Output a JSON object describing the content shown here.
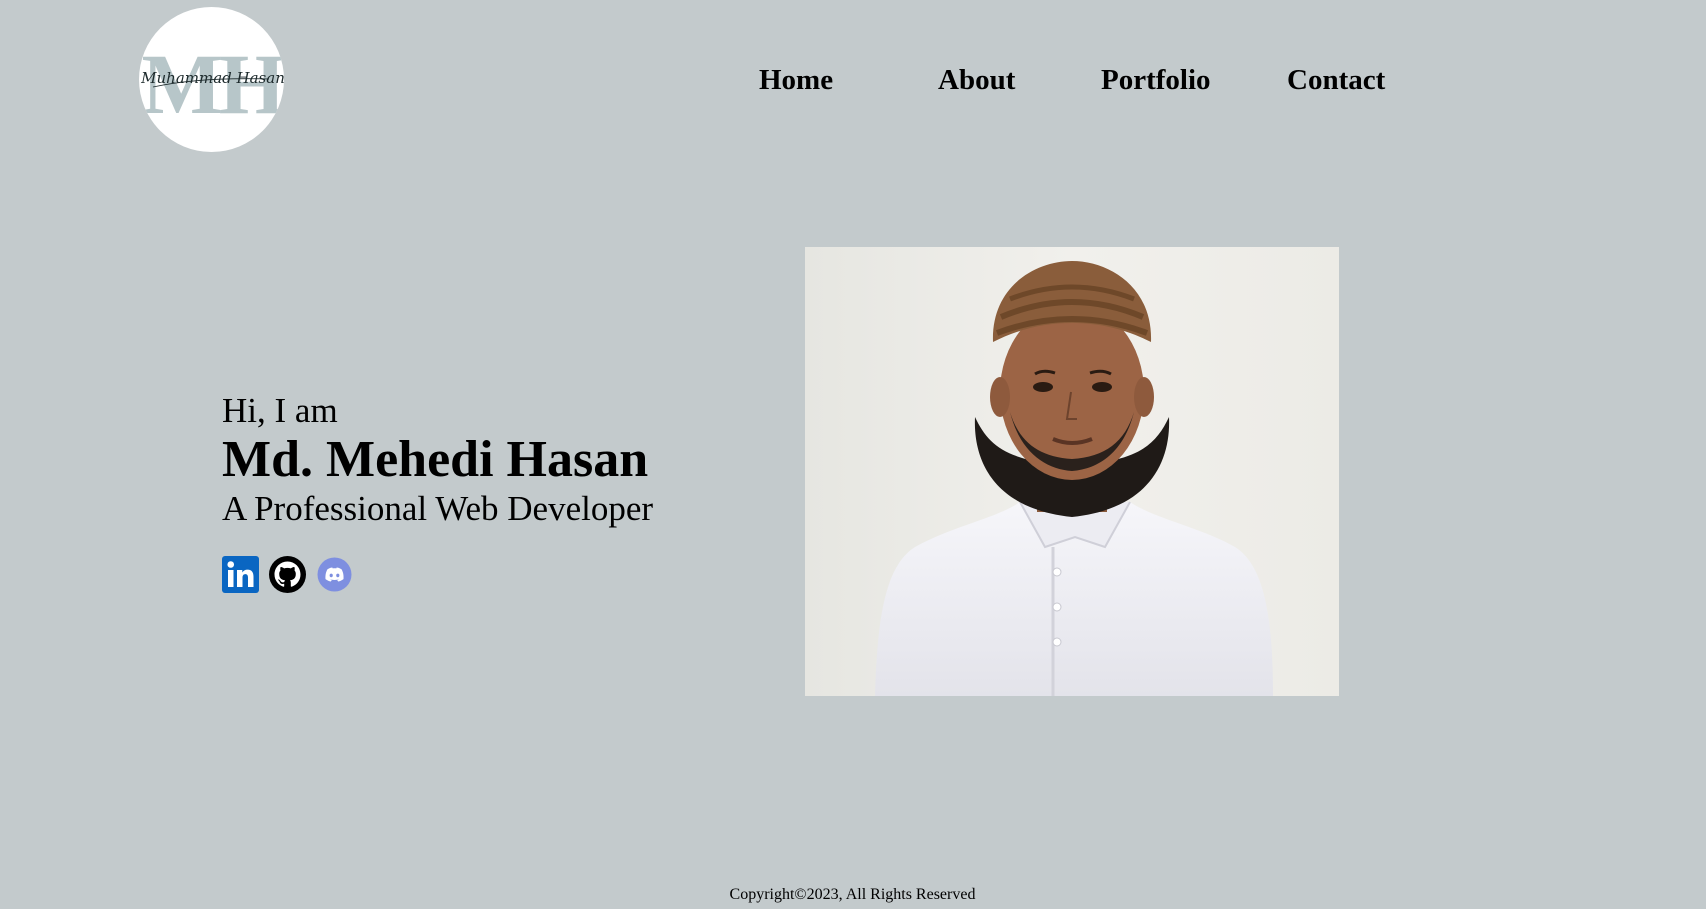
{
  "logo": {
    "letters": "MH",
    "signature": "Muhammad Hasan"
  },
  "nav": {
    "items": [
      {
        "label": "Home"
      },
      {
        "label": "About"
      },
      {
        "label": "Portfolio"
      },
      {
        "label": "Contact"
      }
    ]
  },
  "hero": {
    "greeting": "Hi, I am",
    "name": "Md. Mehedi Hasan",
    "role": "A Professional Web Developer"
  },
  "socials": {
    "items": [
      {
        "icon": "linkedin-icon",
        "color": "#0a66c2"
      },
      {
        "icon": "github-icon",
        "color": "#000000"
      },
      {
        "icon": "discord-icon",
        "color": "#7289da"
      }
    ]
  },
  "footer": {
    "copyright": "Copyright©2023, All Rights Reserved"
  },
  "colors": {
    "background": "#c3cacc",
    "text": "#000000",
    "logo_letters": "#b7c6c9"
  }
}
